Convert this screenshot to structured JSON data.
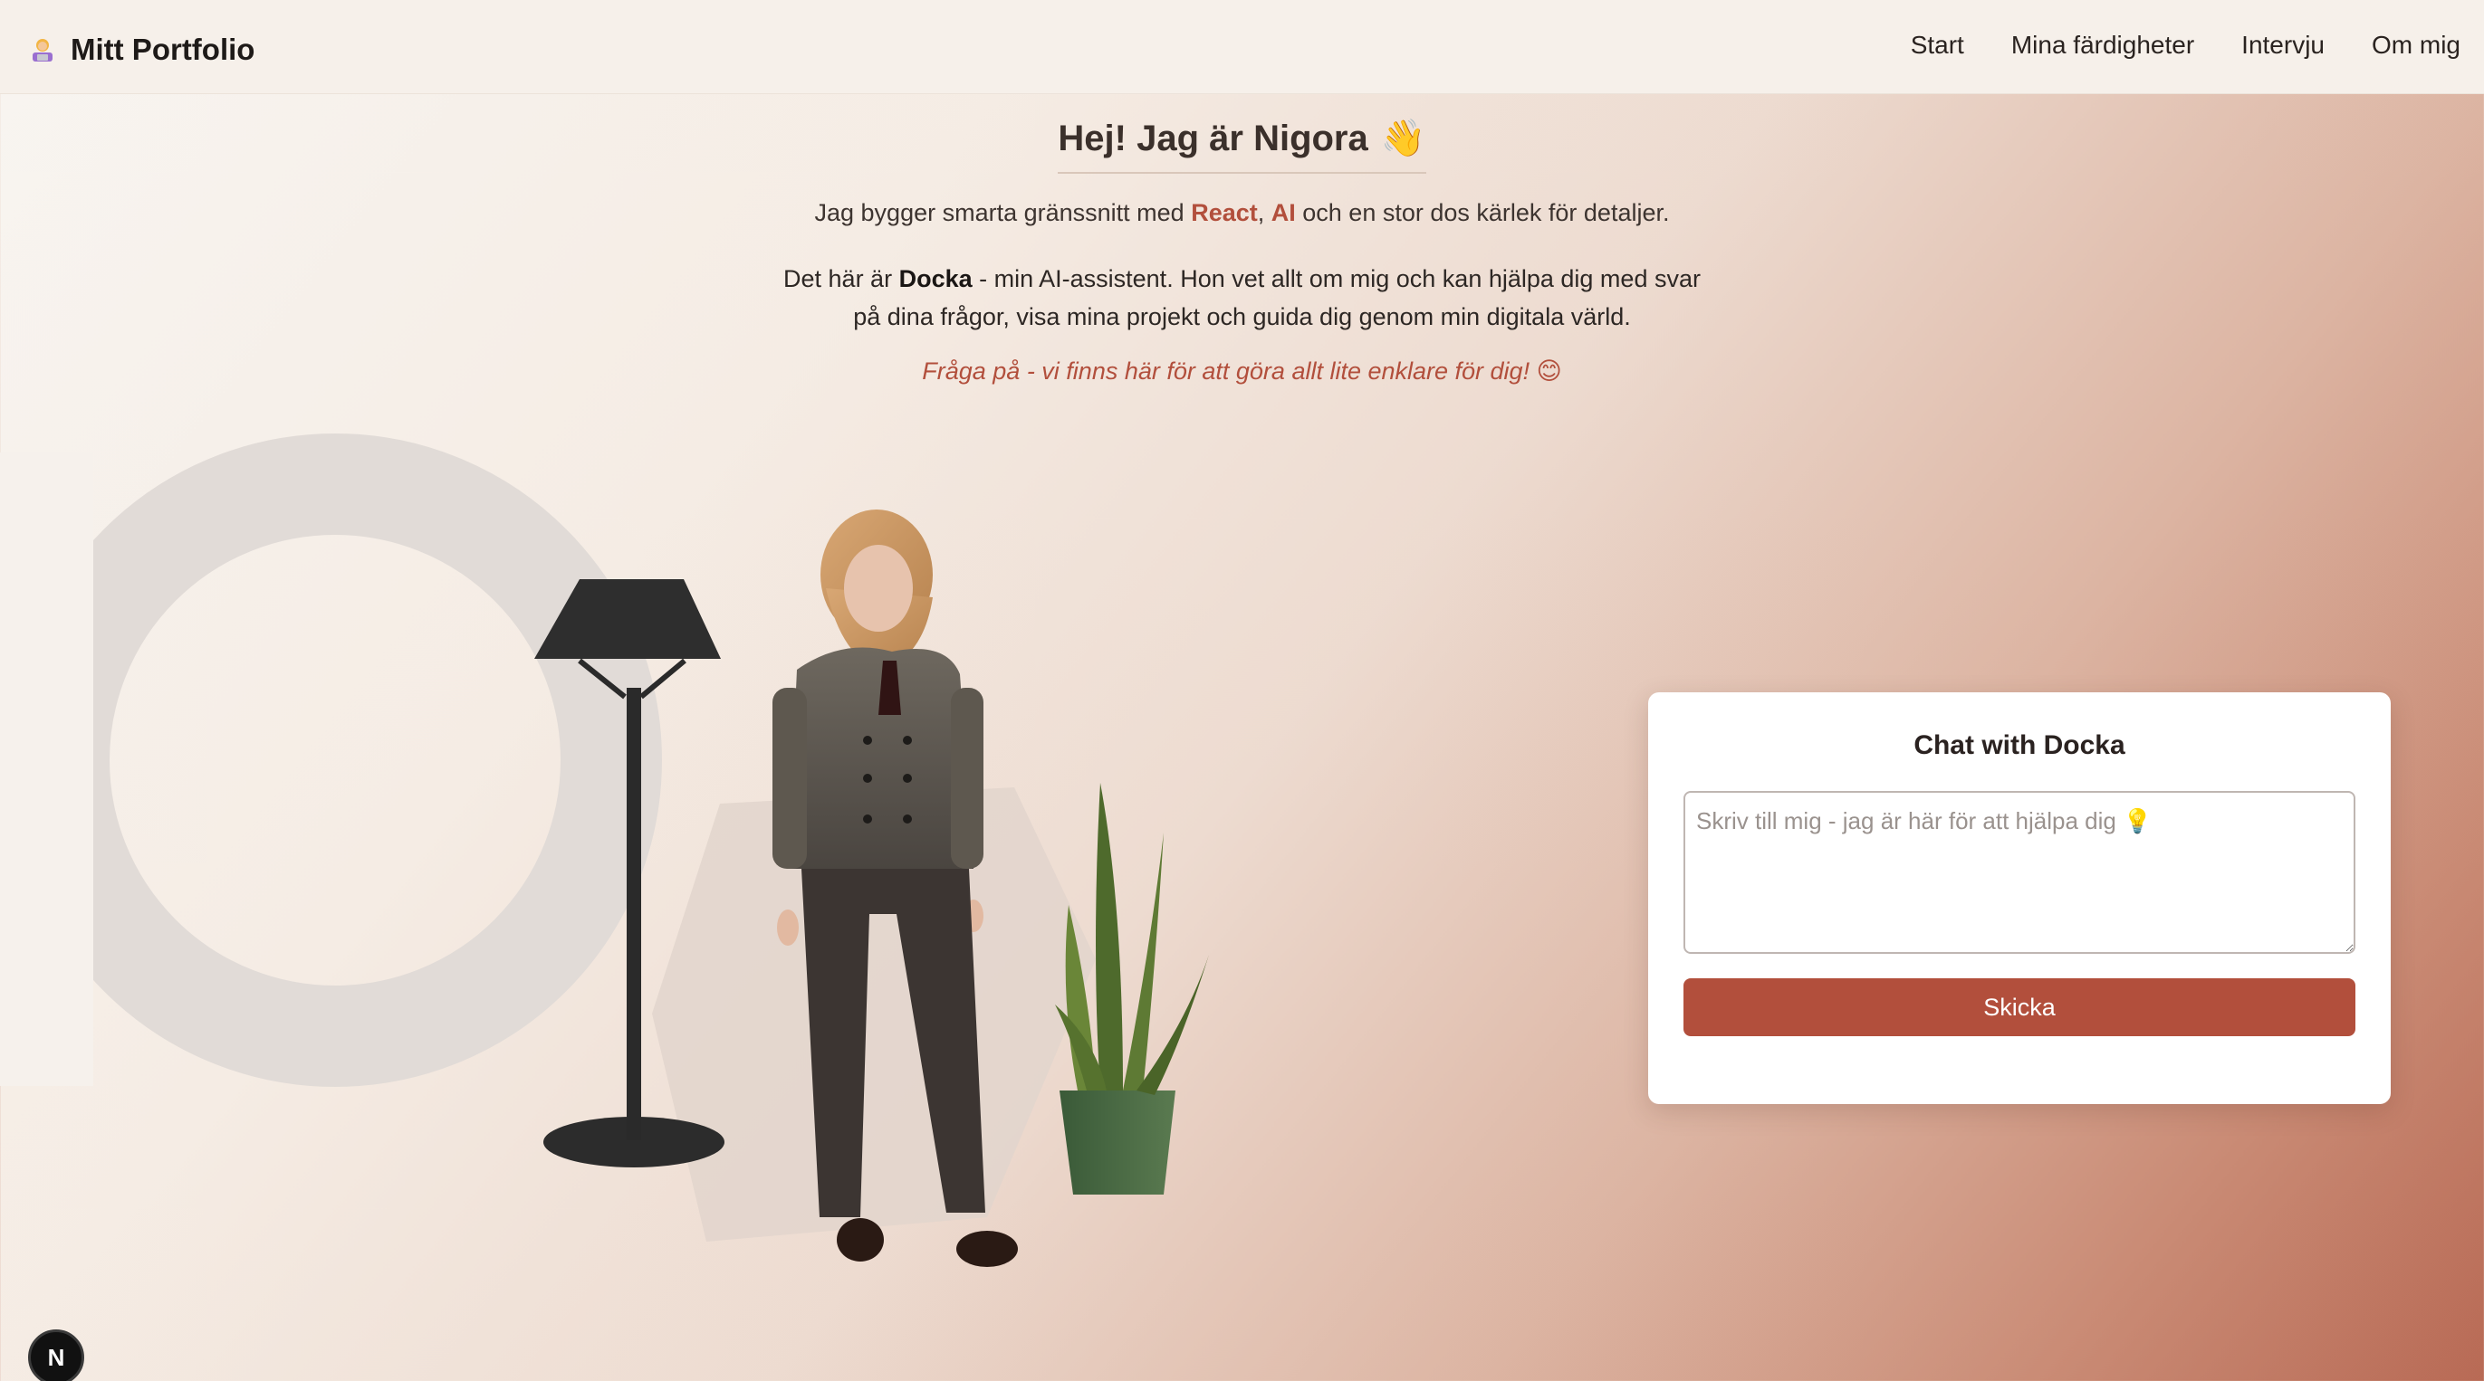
{
  "header": {
    "brand_icon": "woman-technologist-emoji",
    "brand_label": "Mitt Portfolio",
    "nav": [
      {
        "label": "Start"
      },
      {
        "label": "Mina färdigheter"
      },
      {
        "label": "Intervju"
      },
      {
        "label": "Om mig"
      }
    ]
  },
  "hero": {
    "title": "Hej! Jag är Nigora",
    "title_emoji": "👋",
    "intro_prefix": "Jag bygger smarta gränssnitt med ",
    "intro_tech1": "React",
    "intro_sep": ", ",
    "intro_tech2": "AI",
    "intro_suffix": " och en stor dos kärlek för detaljer.",
    "assistant_prefix": "Det här är ",
    "assistant_name": "Docka",
    "assistant_suffix": " - min AI-assistent. Hon vet allt om mig och kan hjälpa dig med svar på dina frågor, visa mina projekt och guida dig genom min digitala värld.",
    "invite": "Fråga på - vi finns här för att göra allt lite enklare för dig! 😊"
  },
  "chat": {
    "title": "Chat with Docka",
    "placeholder": "Skriv till mig - jag är här för att hjälpa dig 💡",
    "value": "",
    "send_label": "Skicka"
  },
  "dev_badge": {
    "label": "N",
    "icon": "nextjs-dev-indicator-icon"
  },
  "colors": {
    "accent": "#b24f3c",
    "header_bg": "#f6f0ea",
    "gradient_start": "#f8f5f1",
    "gradient_end": "#b86a55"
  }
}
